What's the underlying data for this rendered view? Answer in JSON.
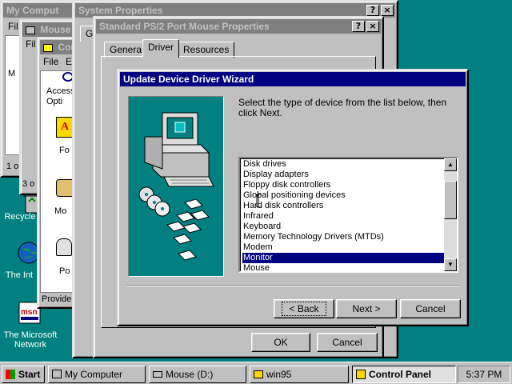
{
  "desktop": {
    "icons": [
      {
        "label": "Recycle"
      },
      {
        "label": "The Int"
      },
      {
        "label": "The Microsoft Network"
      }
    ]
  },
  "windows": {
    "my_computer": {
      "title": "My Comput",
      "menu_file": "Fil",
      "left_frag": "M",
      "status": "1 o"
    },
    "mouse": {
      "title": "Mouse",
      "menu_file": "Fil",
      "status": "3 o"
    },
    "control_panel": {
      "title": "Con",
      "menu_file": "File",
      "menu_edit": "E",
      "items": [
        {
          "label": "Access Opti"
        },
        {
          "label": "Fo"
        },
        {
          "label": "Mo"
        },
        {
          "label": "Po"
        }
      ],
      "status": "Provide"
    },
    "system_properties": {
      "title": "System Properties",
      "tab_frag": "Ge"
    },
    "ps2": {
      "title": "Standard PS/2 Port Mouse Properties",
      "tabs": [
        "General",
        "Driver",
        "Resources"
      ],
      "ok": "OK",
      "cancel": "Cancel"
    }
  },
  "wizard": {
    "title": "Update Device Driver Wizard",
    "instruction": "Select the type of device from the list below, then click Next.",
    "devices": [
      "Disk drives",
      "Display adapters",
      "Floppy disk controllers",
      "Global positioning devices",
      "Hard disk controllers",
      "Infrared",
      "Keyboard",
      "Memory Technology Drivers (MTDs)",
      "Modem",
      "Monitor",
      "Mouse"
    ],
    "selected": "Monitor",
    "back": "< Back",
    "next": "Next >",
    "cancel": "Cancel"
  },
  "title_buttons": {
    "help": "?",
    "close": "×"
  },
  "taskbar": {
    "start": "Start",
    "items": [
      "My Computer",
      "Mouse (D:)",
      "win95",
      "Control Panel"
    ],
    "active": "Control Panel",
    "clock": "5:37 PM"
  },
  "colors": {
    "desktop": "#008080",
    "titlebar_active": "#000080",
    "titlebar_inactive": "#808080",
    "wizard_art_bg": "#008080"
  }
}
